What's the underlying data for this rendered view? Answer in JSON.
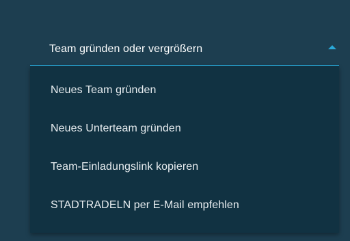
{
  "dropdown": {
    "label": "Team gründen oder vergrößern",
    "expanded_icon": "caret-up-icon",
    "accent_color": "#2aa8d8",
    "items": [
      {
        "label": "Neues Team gründen"
      },
      {
        "label": "Neues Unterteam gründen"
      },
      {
        "label": "Team-Einladungslink kopieren"
      },
      {
        "label": "STADTRADELN per E-Mail empfehlen"
      }
    ]
  },
  "colors": {
    "background": "#1d3e50",
    "menu_background": "#113242",
    "text": "#ffffff"
  }
}
